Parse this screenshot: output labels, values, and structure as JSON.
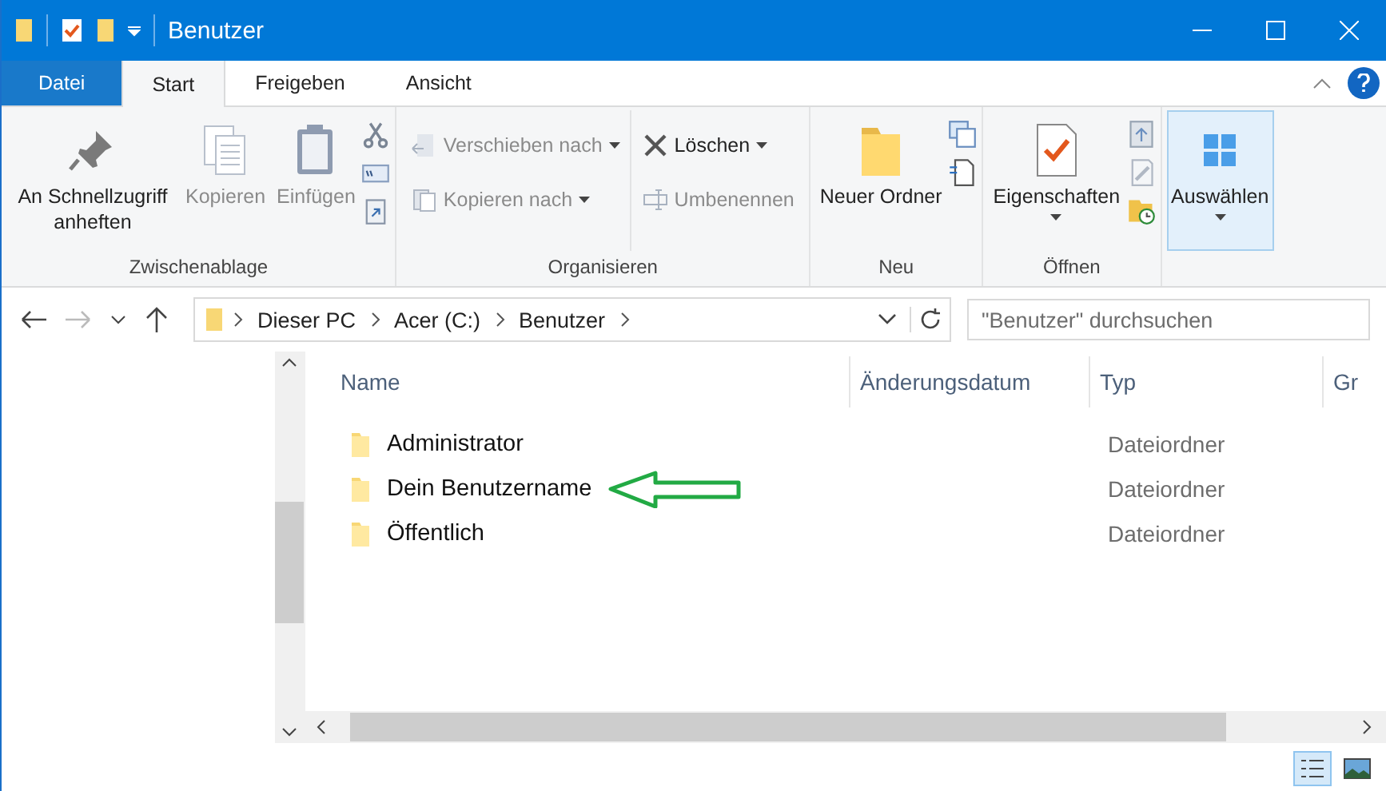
{
  "window": {
    "title": "Benutzer"
  },
  "ribbon_tabs": [
    {
      "label": "Datei",
      "kind": "file",
      "selected": false
    },
    {
      "label": "Start",
      "kind": "tab",
      "selected": true
    },
    {
      "label": "Freigeben",
      "kind": "tab",
      "selected": false
    },
    {
      "label": "Ansicht",
      "kind": "tab",
      "selected": false
    }
  ],
  "ribbon_groups": [
    {
      "label": "Zwischenablage",
      "items": [
        {
          "kind": "large",
          "label": "An Schnellzugriff anheften",
          "disabled": false
        },
        {
          "kind": "large",
          "label": "Kopieren",
          "disabled": true
        },
        {
          "kind": "large",
          "label": "Einfügen",
          "disabled": true
        },
        {
          "kind": "smallstack"
        }
      ]
    },
    {
      "label": "Organisieren",
      "items": [
        {
          "kind": "column",
          "buttons": [
            {
              "label": "Verschieben nach",
              "disabled": true,
              "dropdown": true
            },
            {
              "label": "Kopieren nach",
              "disabled": true,
              "dropdown": true
            }
          ]
        },
        {
          "kind": "column",
          "buttons": [
            {
              "label": "Löschen",
              "disabled": false,
              "dropdown": true
            },
            {
              "label": "Umbenennen",
              "disabled": true,
              "dropdown": false
            }
          ]
        }
      ]
    },
    {
      "label": "Neu",
      "items": [
        {
          "kind": "large",
          "label": "Neuer Ordner",
          "disabled": false
        },
        {
          "kind": "smallstack"
        }
      ]
    },
    {
      "label": "Öffnen",
      "items": [
        {
          "kind": "large",
          "label": "Eigenschaften",
          "disabled": false,
          "dropdown": true
        },
        {
          "kind": "smallstack"
        }
      ]
    },
    {
      "items": [
        {
          "kind": "large",
          "label": "Auswählen",
          "disabled": false,
          "dropdown": true,
          "selected": true
        }
      ]
    }
  ],
  "address": {
    "crumbs": [
      "Dieser PC",
      "Acer (C:)",
      "Benutzer"
    ]
  },
  "search": {
    "placeholder": "\"Benutzer\" durchsuchen"
  },
  "table": {
    "columns": [
      "Name",
      "Änderungsdatum",
      "Typ",
      "Gr"
    ],
    "rows": [
      {
        "name": "Administrator",
        "type": "Dateiordner",
        "marked": false
      },
      {
        "name": "Dein Benutzername",
        "type": "Dateiordner",
        "marked": true
      },
      {
        "name": "Öffentlich",
        "type": "Dateiordner",
        "marked": false
      }
    ]
  },
  "view_buttons": [
    {
      "kind": "details",
      "selected": true
    },
    {
      "kind": "tiles",
      "selected": false
    }
  ]
}
